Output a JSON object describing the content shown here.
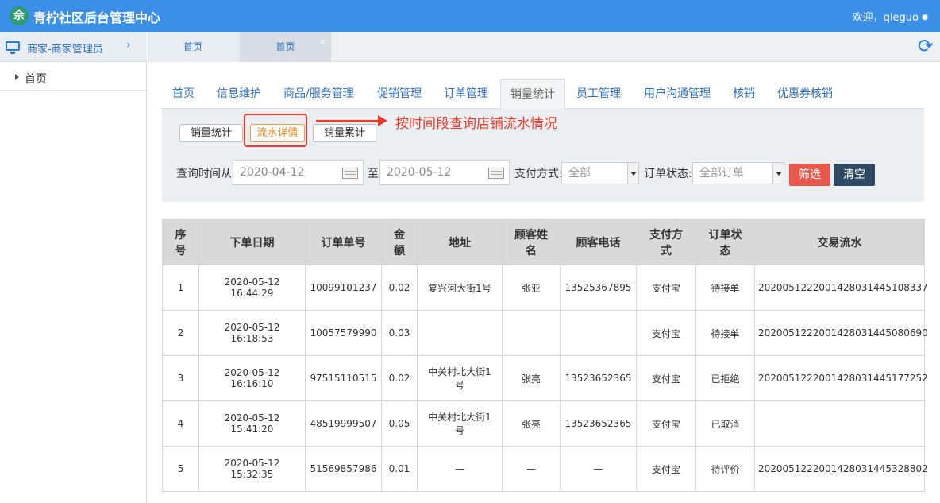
{
  "header": {
    "logo_glyph": "佘",
    "title": "青柠社区后台管理中心",
    "welcome": "欢迎，qieguo",
    "gear_icon": "gear-icon"
  },
  "sidebar": {
    "section_title": "商家-商家管理员",
    "arrow": "›",
    "items": [
      {
        "label": "首页"
      }
    ]
  },
  "tabs": [
    {
      "label": "首页"
    },
    {
      "label": "首页",
      "close": "×"
    }
  ],
  "nav": {
    "items": [
      {
        "label": "首页"
      },
      {
        "label": "信息维护"
      },
      {
        "label": "商品/服务管理"
      },
      {
        "label": "促销管理"
      },
      {
        "label": "订单管理"
      },
      {
        "label": "销量统计"
      },
      {
        "label": "员工管理"
      },
      {
        "label": "用户沟通管理"
      },
      {
        "label": "核销"
      },
      {
        "label": "优惠券核销"
      }
    ],
    "active": "销量统计"
  },
  "sub_tabs": [
    {
      "label": "销量统计"
    },
    {
      "label": "流水详情"
    },
    {
      "label": "销量累计"
    }
  ],
  "annotation": "按时间段查询店铺流水情况",
  "filter": {
    "time_label": "查询时间从",
    "start_date": "2020-04-12",
    "to_label": "至",
    "end_date": "2020-05-12",
    "payment_label": "支付方式:",
    "payment_value": "全部",
    "status_label": "订单状态:",
    "status_value": "全部订单",
    "filter_button": "筛选",
    "clear_button": "清空"
  },
  "table": {
    "headers": [
      [
        "序",
        "号"
      ],
      [
        "下单日期"
      ],
      [
        "订单单号"
      ],
      [
        "金",
        "额"
      ],
      [
        "地址"
      ],
      [
        "顾客姓",
        "名"
      ],
      [
        "顾客电话"
      ],
      [
        "支付方",
        "式"
      ],
      [
        "订单状",
        "态"
      ],
      [
        "交易流水"
      ]
    ],
    "rows": [
      {
        "no": "1",
        "date": "2020-05-12",
        "time": "16:44:29",
        "order": "10099101237",
        "amount": "0.02",
        "addr1": "复兴河大街1号",
        "addr2": "",
        "name": "张亚",
        "phone": "13525367895",
        "pay": "支付宝",
        "status": "待接单",
        "txn": "202005122200142803144510833 7"
      },
      {
        "no": "2",
        "date": "2020-05-12",
        "time": "16:18:53",
        "order": "10057579990",
        "amount": "0.03",
        "addr1": "",
        "addr2": "",
        "name": "",
        "phone": "",
        "pay": "支付宝",
        "status": "待接单",
        "txn": "2020051222001428031445080690"
      },
      {
        "no": "3",
        "date": "2020-05-12",
        "time": "16:16:10",
        "order": "97515110515",
        "amount": "0.02",
        "addr1": "中关村北大街1",
        "addr2": "号",
        "name": "张亮",
        "phone": "13523652365",
        "pay": "支付宝",
        "status": "已拒绝",
        "txn": "2020051222001428031445177252"
      },
      {
        "no": "4",
        "date": "2020-05-12",
        "time": "15:41:20",
        "order": "48519999507",
        "amount": "0.05",
        "addr1": "中关村北大街1",
        "addr2": "号",
        "name": "张亮",
        "phone": "13523652365",
        "pay": "支付宝",
        "status": "已取消",
        "txn": ""
      },
      {
        "no": "5",
        "date": "2020-05-12",
        "time": "15:32:35",
        "order": "51569857986",
        "amount": "0.01",
        "addr1": "—",
        "addr2": "",
        "name": "—",
        "phone": "—",
        "pay": "支付宝",
        "status": "待评价",
        "txn": "2020051222001428031445328802"
      }
    ]
  }
}
